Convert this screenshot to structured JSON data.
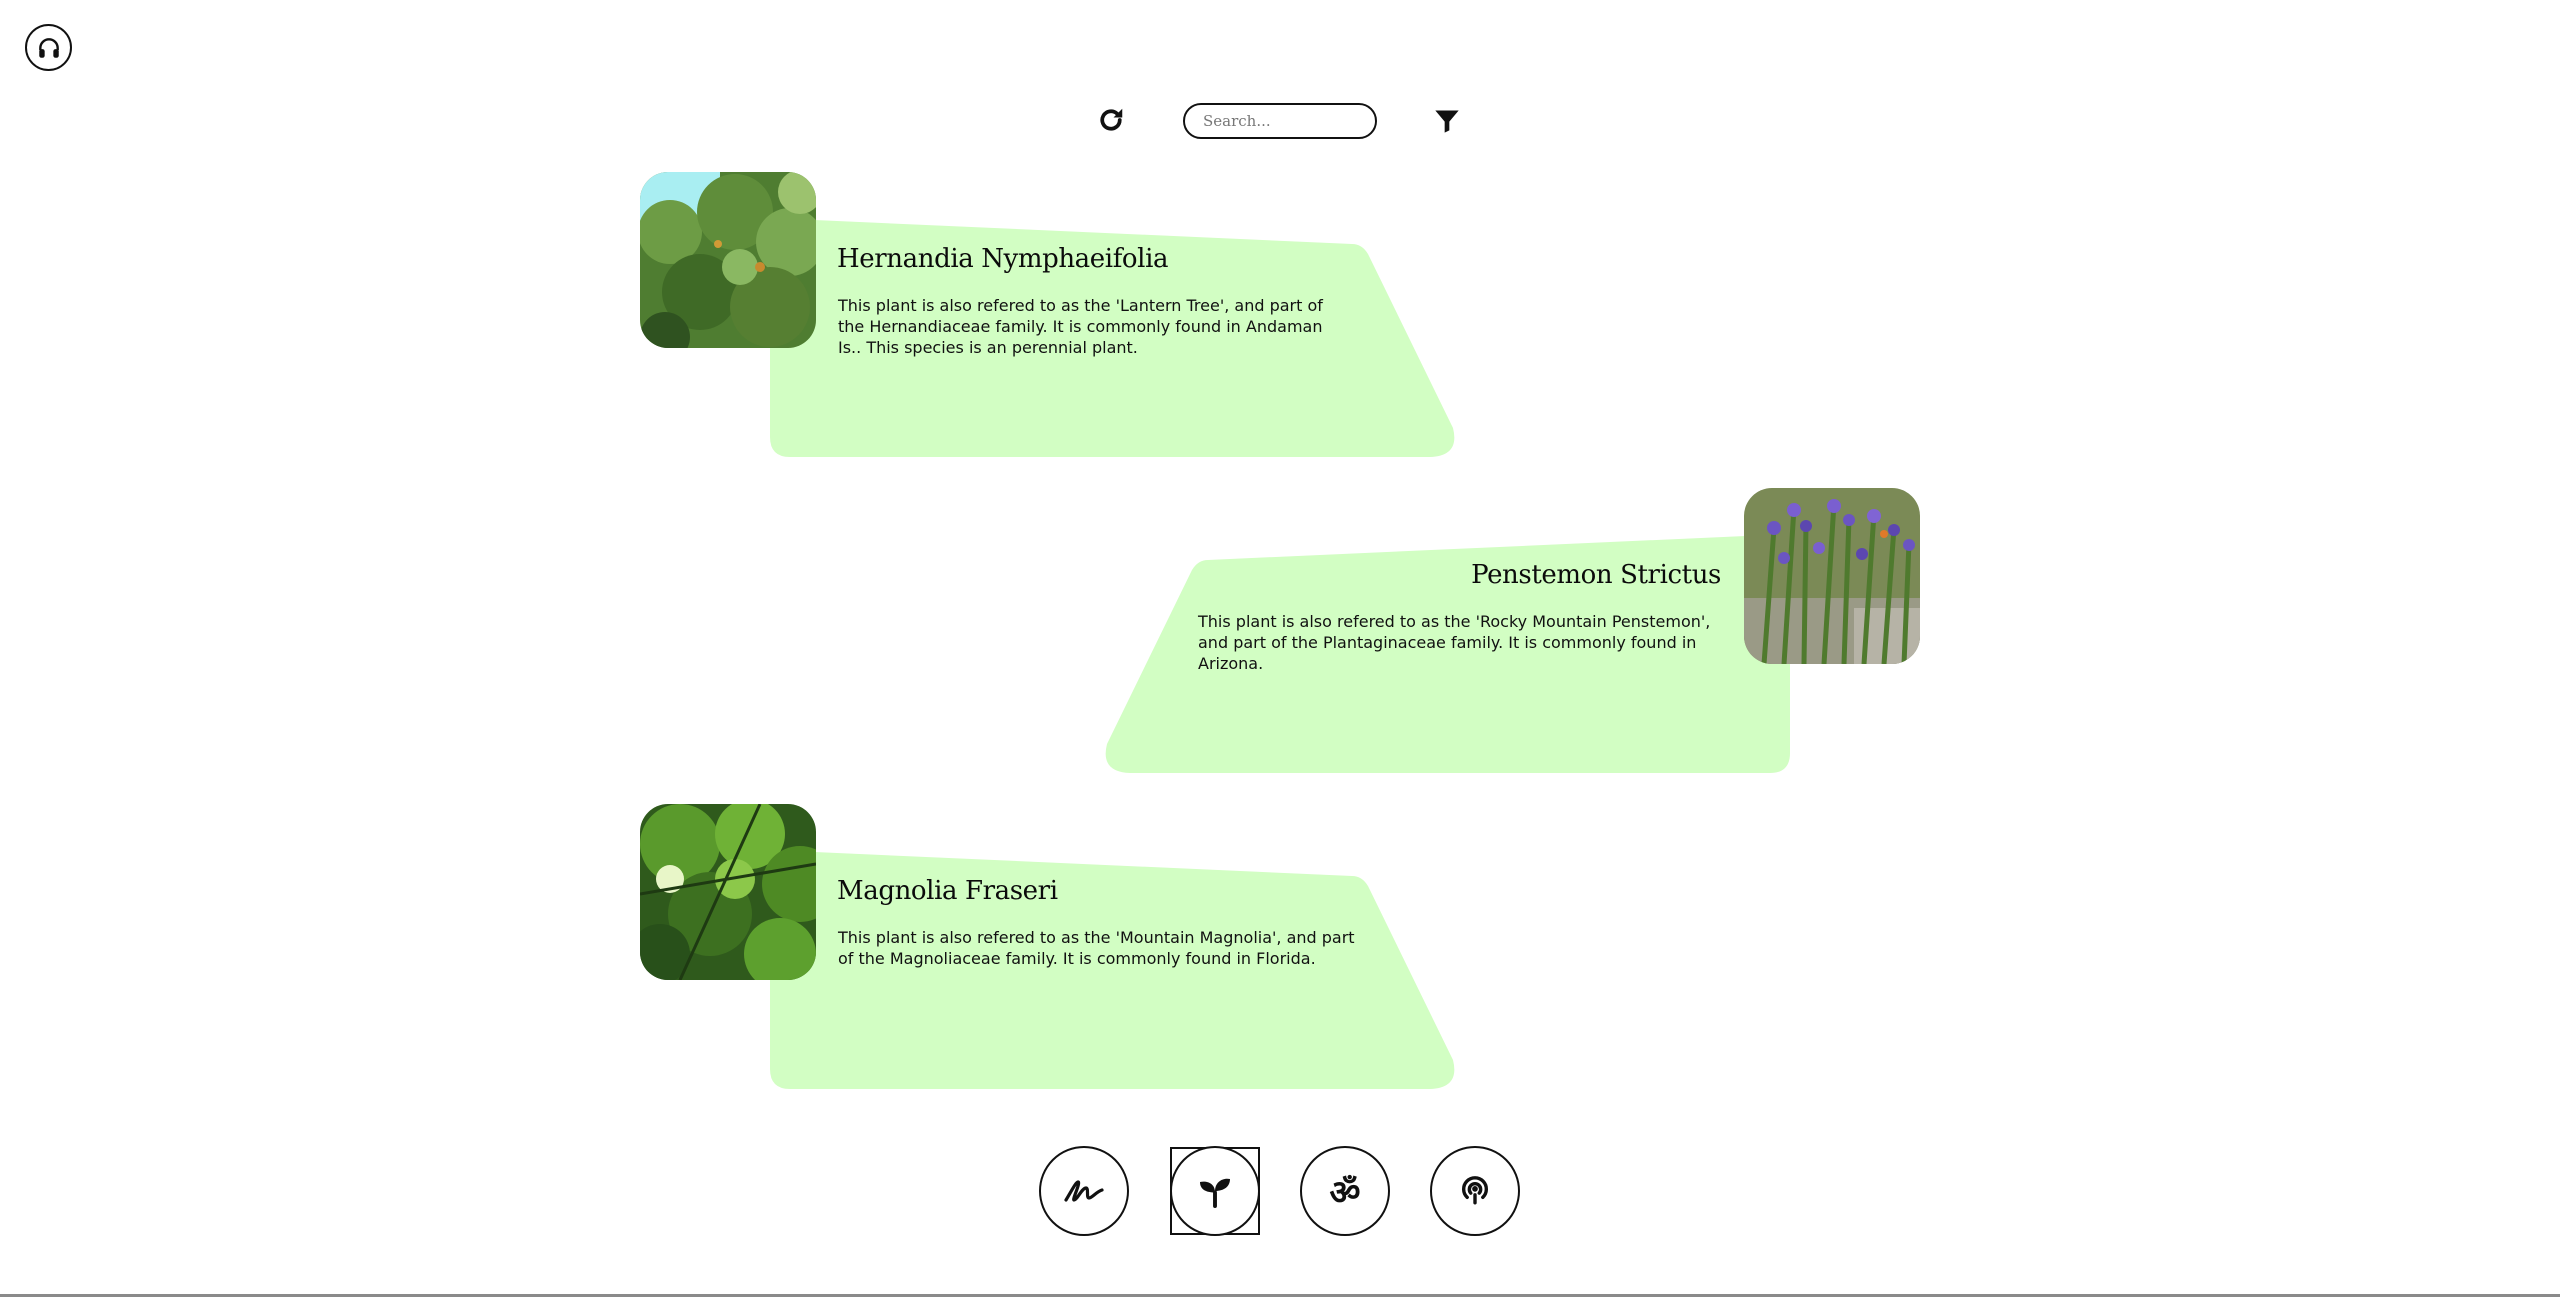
{
  "header": {
    "audio_icon": "headphones-icon"
  },
  "toolbar": {
    "refresh_icon": "refresh-icon",
    "search_placeholder": "Search...",
    "search_value": "",
    "filter_icon": "filter-icon"
  },
  "plants": [
    {
      "name": "Hernandia Nymphaeifolia",
      "description": "This plant is also refered to as the 'Lantern Tree', and part of the Hernandiaceae family. It is commonly found in Andaman Is.. This species is an perennial plant."
    },
    {
      "name": "Penstemon Strictus",
      "description": "This plant is also refered to as the 'Rocky Mountain Penstemon', and part of the Plantaginaceae family. It is commonly found in Arizona."
    },
    {
      "name": "Magnolia Fraseri",
      "description": "This plant is also refered to as the 'Mountain Magnolia', and part of the Magnoliaceae family. It is commonly found in Florida."
    }
  ],
  "bottom_nav": {
    "items": [
      {
        "icon": "signature-icon",
        "active": false
      },
      {
        "icon": "sprout-icon",
        "active": true
      },
      {
        "icon": "om-icon",
        "glyph": "ॐ",
        "active": false
      },
      {
        "icon": "podcast-icon",
        "active": false
      }
    ]
  },
  "colors": {
    "card_background": "#d2fec3",
    "text": "#111111",
    "background": "#ffffff"
  }
}
